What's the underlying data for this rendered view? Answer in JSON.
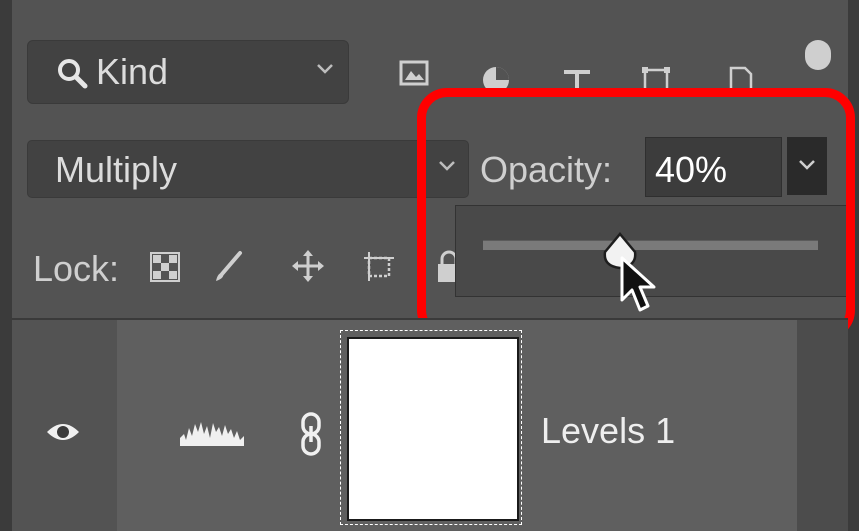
{
  "filter": {
    "kind_label": "Kind"
  },
  "blend": {
    "mode": "Multiply"
  },
  "opacity": {
    "label": "Opacity:",
    "value": "40%",
    "slider_fraction": 0.4
  },
  "lock": {
    "label": "Lock:"
  },
  "layer": {
    "name": "Levels 1"
  },
  "colors": {
    "highlight": "#ff0000",
    "panel": "#535353"
  },
  "icons": [
    "search-icon",
    "chevron-down-icon",
    "pixel-layer-filter-icon",
    "adjustment-filter-icon",
    "type-filter-icon",
    "shape-filter-icon",
    "smart-object-filter-icon",
    "lock-transparent-icon",
    "lock-image-icon",
    "lock-position-icon",
    "lock-artboard-icon",
    "lock-all-icon",
    "eye-icon",
    "levels-histogram-icon",
    "chain-link-icon",
    "cursor-arrow-icon"
  ]
}
